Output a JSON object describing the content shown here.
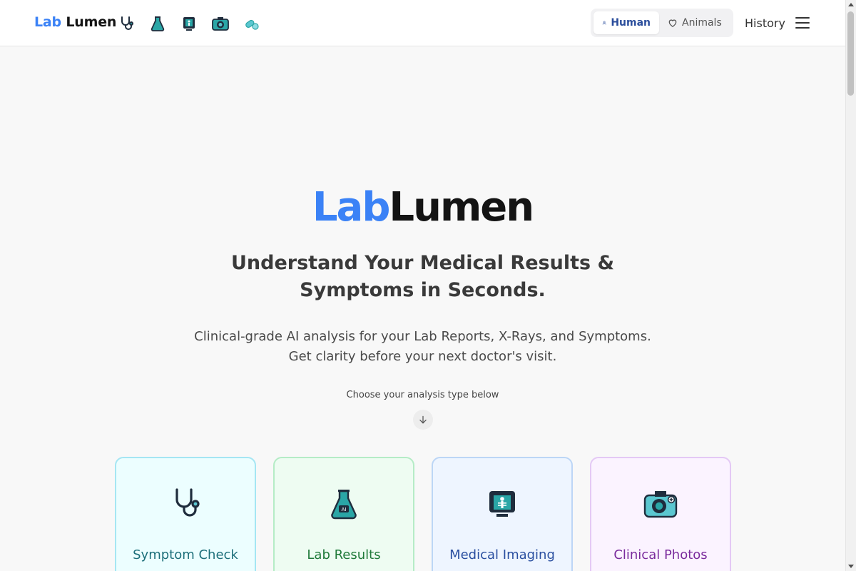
{
  "brand": {
    "lab": "Lab",
    "lumen": "Lumen"
  },
  "nav_icons": [
    "stethoscope-icon",
    "lab-flask-icon",
    "xray-monitor-icon",
    "camera-icon",
    "pills-icon"
  ],
  "toggle": {
    "human": {
      "label": "Human",
      "icon": "person-icon",
      "active": true
    },
    "animals": {
      "label": "Animals",
      "icon": "heart-icon",
      "active": false
    }
  },
  "history_label": "History",
  "hero": {
    "lab": "Lab",
    "lumen": "Lumen",
    "subtitle": "Understand Your Medical Results & Symptoms in Seconds.",
    "desc_line1": "Clinical-grade AI analysis for your Lab Reports, X-Rays, and Symptoms.",
    "desc_line2": "Get clarity before your next doctor's visit.",
    "choose": "Choose your analysis type below"
  },
  "cards": [
    {
      "label": "Symptom Check",
      "icon": "stethoscope-icon"
    },
    {
      "label": "Lab Results",
      "icon": "ai-flask-icon"
    },
    {
      "label": "Medical Imaging",
      "icon": "xray-monitor-icon"
    },
    {
      "label": "Clinical Photos",
      "icon": "camera-icon"
    }
  ],
  "colors": {
    "accent": "#3b82f6",
    "teal": "#2aa6a6"
  }
}
